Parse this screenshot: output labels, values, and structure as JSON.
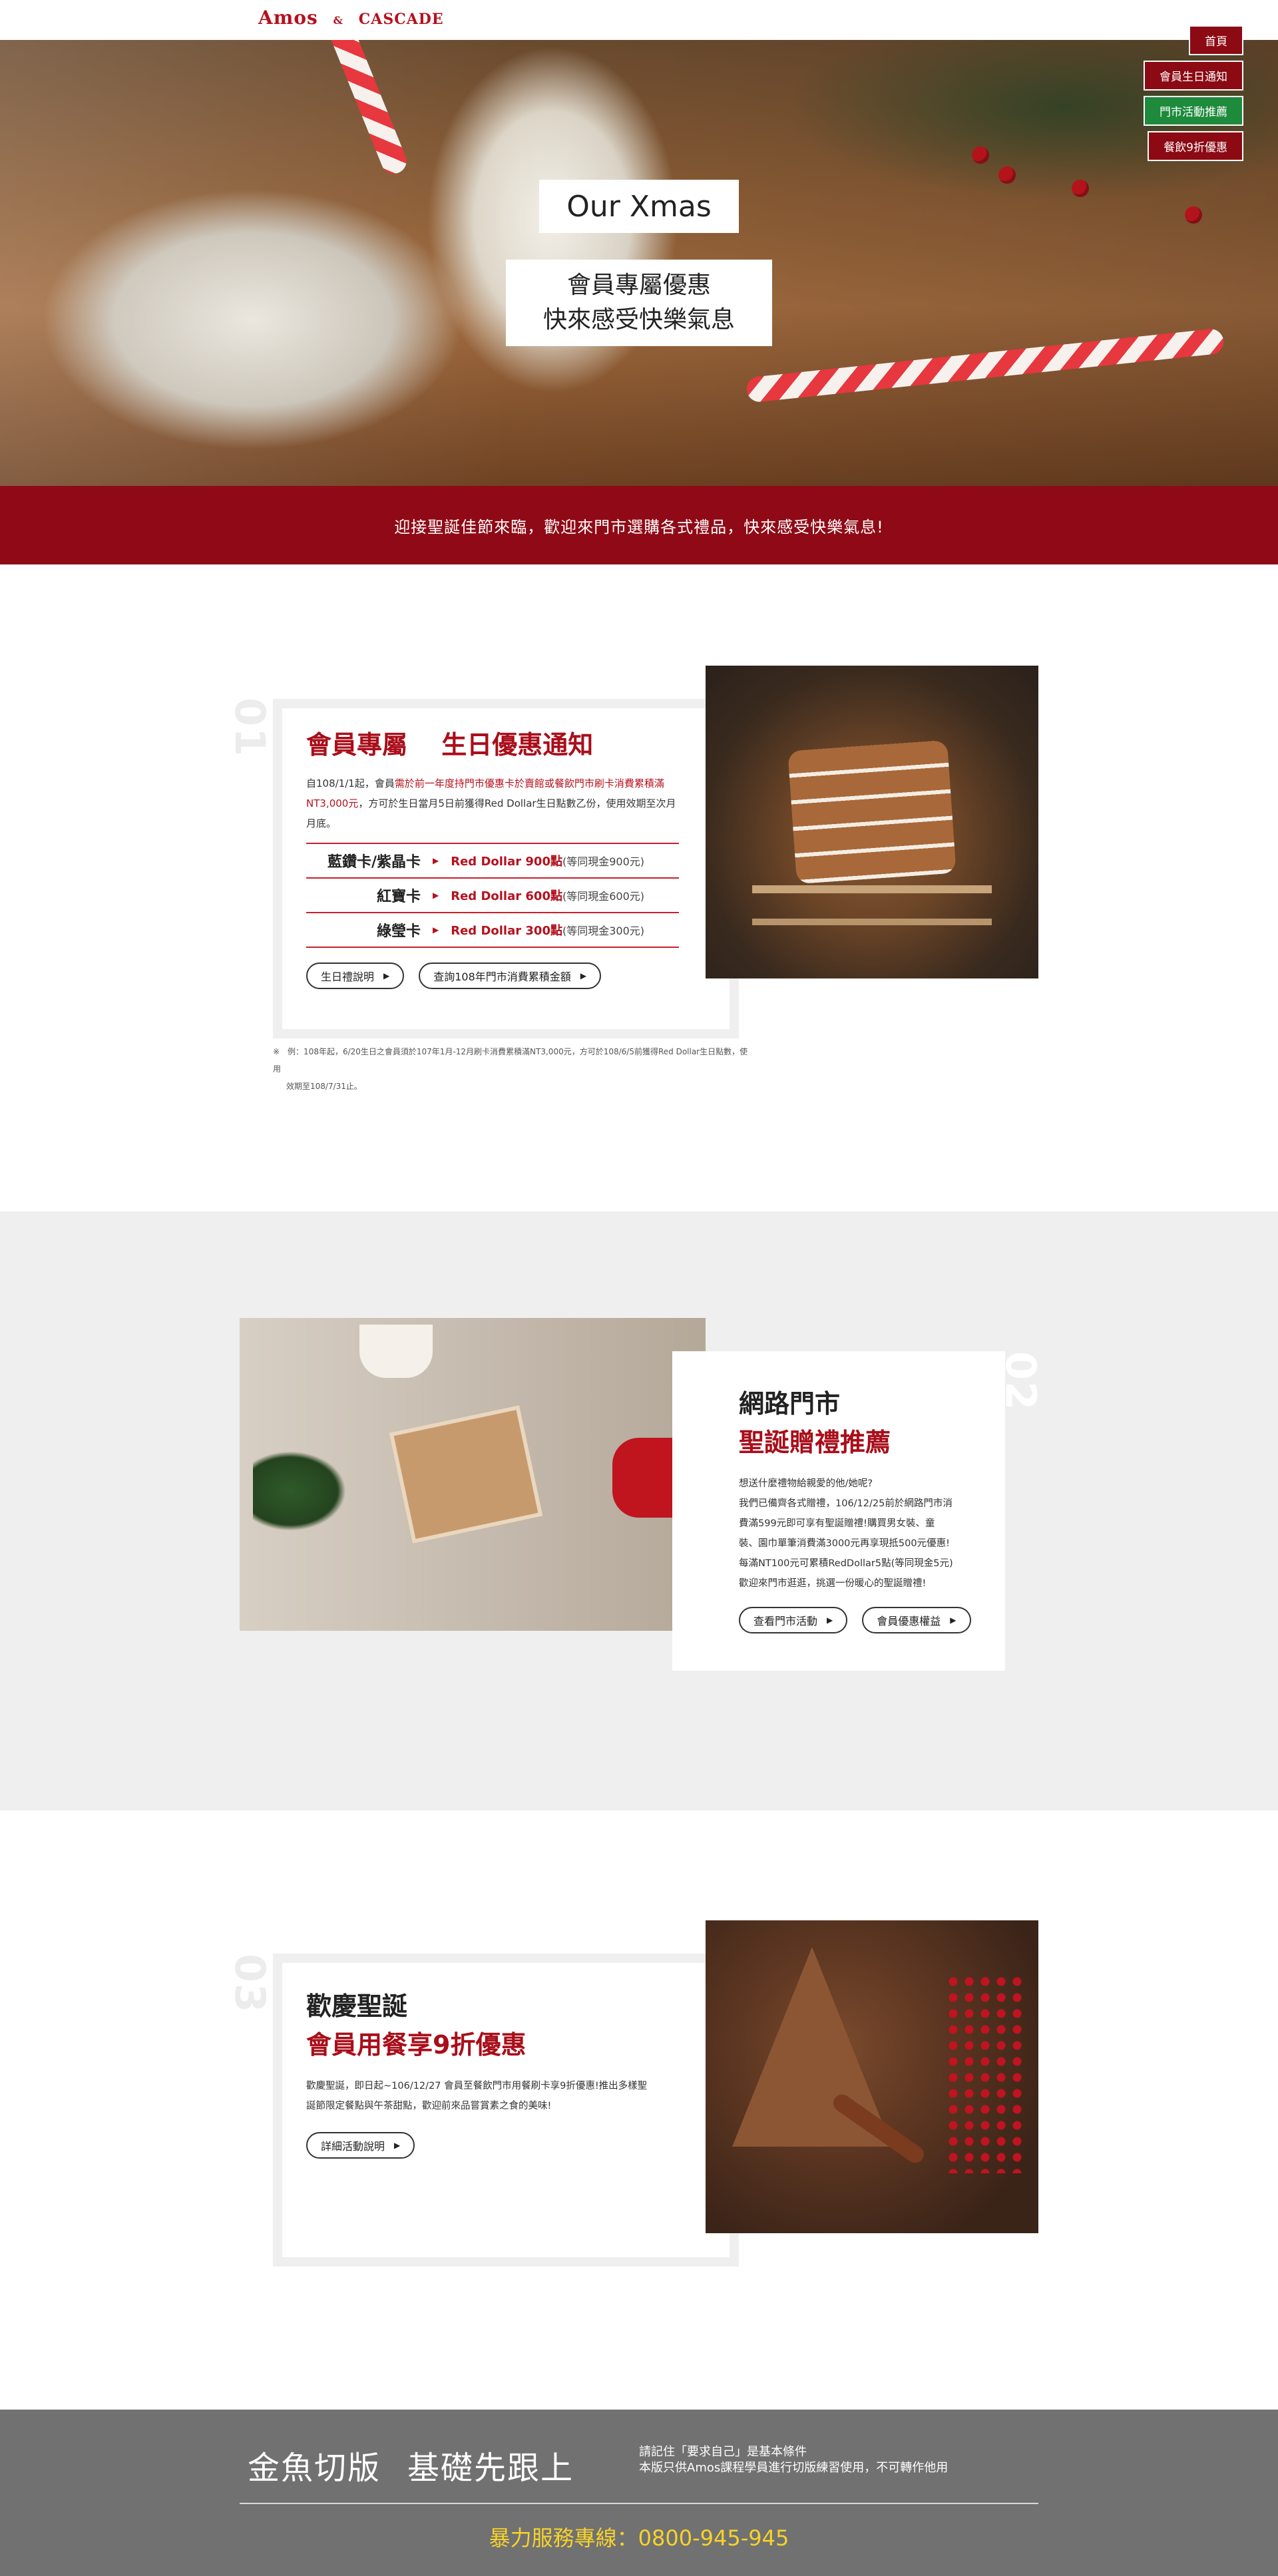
{
  "header": {
    "logo_main": "Amos",
    "logo_amp": "&",
    "logo_sub": "CASCADE"
  },
  "nav": {
    "items": [
      {
        "label": "首頁"
      },
      {
        "label": "會員生日通知"
      },
      {
        "label": "門市活動推薦"
      },
      {
        "label": "餐飲9折優惠"
      }
    ],
    "active_index": 2
  },
  "hero": {
    "title": "Our Xmas",
    "sub_line1": "會員專屬優惠",
    "sub_line2": "快來感受快樂氣息"
  },
  "banner": {
    "text": "迎接聖誕佳節來臨，歡迎來門市選購各式禮品，快來感受快樂氣息!"
  },
  "section1": {
    "num": "01",
    "title_a": "會員專屬",
    "title_b": "生日優惠通知",
    "text_pre": "自108/1/1起，會員",
    "text_hl": "需於前一年度持門市優惠卡於賣館或餐飲門市刷卡消費累積滿NT3,000元",
    "text_post": "，方可於生日當月5日前獲得Red Dollar生日點數乙份，使用效期至次月月底。",
    "perks": [
      {
        "label": "藍鑽卡/紫晶卡",
        "value": "Red Dollar 900點",
        "note": "(等同現金900元)"
      },
      {
        "label": "紅寶卡",
        "value": "Red Dollar 600點",
        "note": "(等同現金600元)"
      },
      {
        "label": "綠瑩卡",
        "value": "Red Dollar 300點",
        "note": "(等同現金300元)"
      }
    ],
    "btn1": "生日禮說明",
    "btn2": "查詢108年門市消費累積金額",
    "note_line1": "※　例：108年起，6/20生日之會員須於107年1月-12月刷卡消費累積滿NT3,000元，方可於108/6/5前獲得Red Dollar生日點數，使用",
    "note_line2": "效期至108/7/31止。"
  },
  "section2": {
    "num": "02",
    "title_a": "網路門市",
    "title_b": "聖誕贈禮推薦",
    "lines": [
      "想送什麼禮物給親愛的他/她呢?",
      "我們已備齊各式贈禮，106/12/25前於網路門市消",
      "費滿599元即可享有聖誕贈禮!購買男女裝、童",
      "裝、園巾單筆消費滿3000元再享現抵500元優惠!",
      "每滿NT100元可累積RedDollar5點(等同現金5元)",
      "歡迎來門市逛逛，挑選一份暖心的聖誕贈禮!"
    ],
    "btn1": "查看門市活動",
    "btn2": "會員優惠權益"
  },
  "section3": {
    "num": "03",
    "title_a": "歡慶聖誕",
    "title_b": "會員用餐享9折優惠",
    "line1": "歡慶聖誕，即日起~106/12/27 會員至餐飲門市用餐刷卡享9折優惠!推出多樣聖",
    "line2": "誕節限定餐點與午茶甜點，歡迎前來品嘗賞素之食的美味!",
    "btn1": "詳細活動說明"
  },
  "footer": {
    "slogan_a": "金魚切版",
    "slogan_b": "基礎先跟上",
    "remind_1": "請記住「要求自己」是基本條件",
    "remind_2": "本版只供Amos課程學員進行切版練習使用，不可轉作他用",
    "hotline": "暴力服務專線：0800-945-945"
  },
  "colors": {
    "brand_red": "#8f0a16",
    "accent_red": "#b5111d",
    "active_green": "#1d8a3c",
    "footer_gray": "#717171",
    "hotline_yellow": "#f6d32a"
  }
}
